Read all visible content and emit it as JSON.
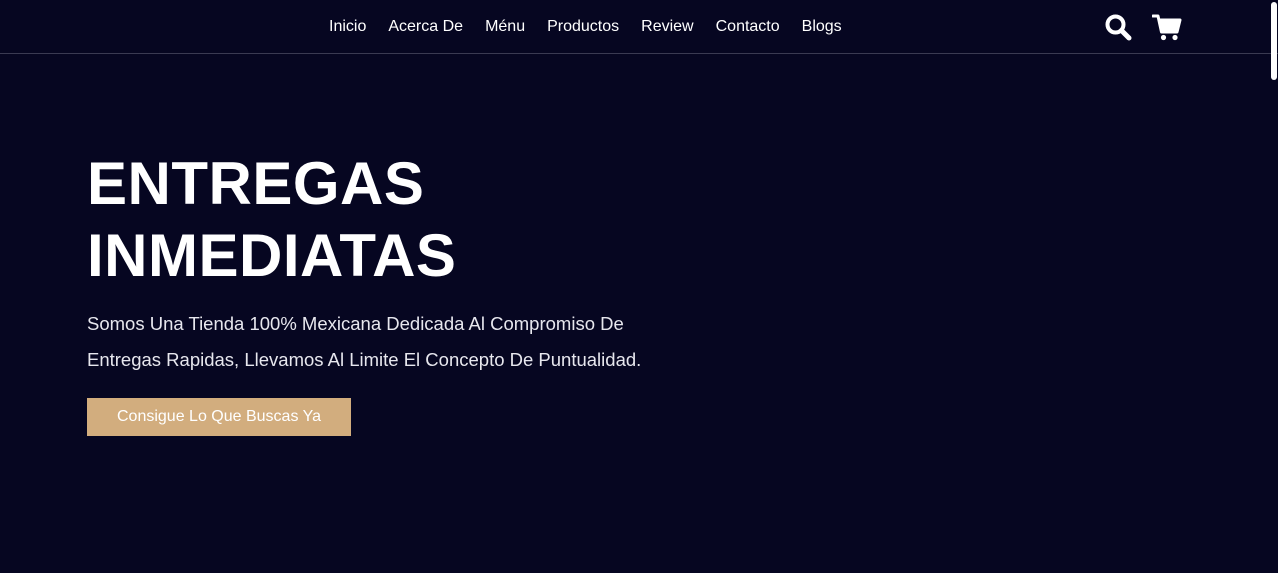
{
  "nav": {
    "items": [
      {
        "label": "Inicio"
      },
      {
        "label": "Acerca De"
      },
      {
        "label": "Ménu"
      },
      {
        "label": "Productos"
      },
      {
        "label": "Review"
      },
      {
        "label": "Contacto"
      },
      {
        "label": "Blogs"
      }
    ]
  },
  "header_icons": {
    "search": "search-icon",
    "cart": "shopping-cart-icon"
  },
  "hero": {
    "title_line1": "ENTREGAS",
    "title_line2": "INMEDIATAS",
    "description_line1": "Somos Una Tienda 100% Mexicana Dedicada Al Compromiso De",
    "description_line2": "Entregas Rapidas, Llevamos Al Limite El Concepto De Puntualidad.",
    "cta_label": "Consigue Lo Que Buscas Ya"
  },
  "colors": {
    "background": "#060621",
    "accent": "#d2ad7e",
    "text": "#ffffff"
  }
}
